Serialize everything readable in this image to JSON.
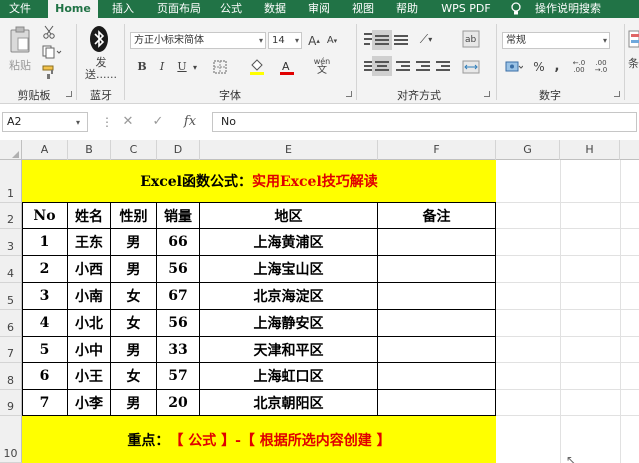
{
  "menu": {
    "tabs": [
      "文件",
      "Home",
      "插入",
      "页面布局",
      "公式",
      "数据",
      "审阅",
      "视图",
      "帮助",
      "WPS PDF",
      "操作说明搜索"
    ],
    "active": "Home"
  },
  "ribbon": {
    "clipboard": {
      "paste_label": "粘贴",
      "group_label": "剪贴板"
    },
    "bluetooth": {
      "send_label": "发送......",
      "group_label": "蓝牙"
    },
    "font": {
      "font_name": "方正小标宋简体",
      "font_size": "14",
      "bold": "B",
      "italic": "I",
      "underline": "U",
      "wen": "wén",
      "group_label": "字体"
    },
    "alignment": {
      "group_label": "对齐方式"
    },
    "number": {
      "format": "常规",
      "percent": "%",
      "comma": ",",
      "group_label": "数字"
    },
    "styles": {
      "truncated_label": "条"
    }
  },
  "formula_bar": {
    "name_box": "A2",
    "cancel": "✕",
    "enter": "✓",
    "fx": "fx",
    "formula": "No"
  },
  "grid": {
    "columns": [
      "A",
      "B",
      "C",
      "D",
      "E",
      "F",
      "G",
      "H"
    ],
    "rows": [
      "1",
      "2",
      "3",
      "4",
      "5",
      "6",
      "7",
      "8",
      "9",
      "10"
    ],
    "title_part1": "Excel函数公式：",
    "title_part2": "实用Excel技巧解读",
    "headers": [
      "No",
      "姓名",
      "性别",
      "销量",
      "地区",
      "备注"
    ],
    "data": [
      [
        "1",
        "王东",
        "男",
        "66",
        "上海黄浦区",
        ""
      ],
      [
        "2",
        "小西",
        "男",
        "56",
        "上海宝山区",
        ""
      ],
      [
        "3",
        "小南",
        "女",
        "67",
        "北京海淀区",
        ""
      ],
      [
        "4",
        "小北",
        "女",
        "56",
        "上海静安区",
        ""
      ],
      [
        "5",
        "小中",
        "男",
        "33",
        "天津和平区",
        ""
      ],
      [
        "6",
        "小王",
        "女",
        "57",
        "上海虹口区",
        ""
      ],
      [
        "7",
        "小李",
        "男",
        "20",
        "北京朝阳区",
        ""
      ]
    ],
    "footer_part1": "重点：",
    "footer_part2": "【 公式 】-【 根据所选内容创建 】"
  },
  "colors": {
    "excel_green": "#217346",
    "banner_yellow": "#ffff00",
    "emphasis_red": "#e00000"
  }
}
